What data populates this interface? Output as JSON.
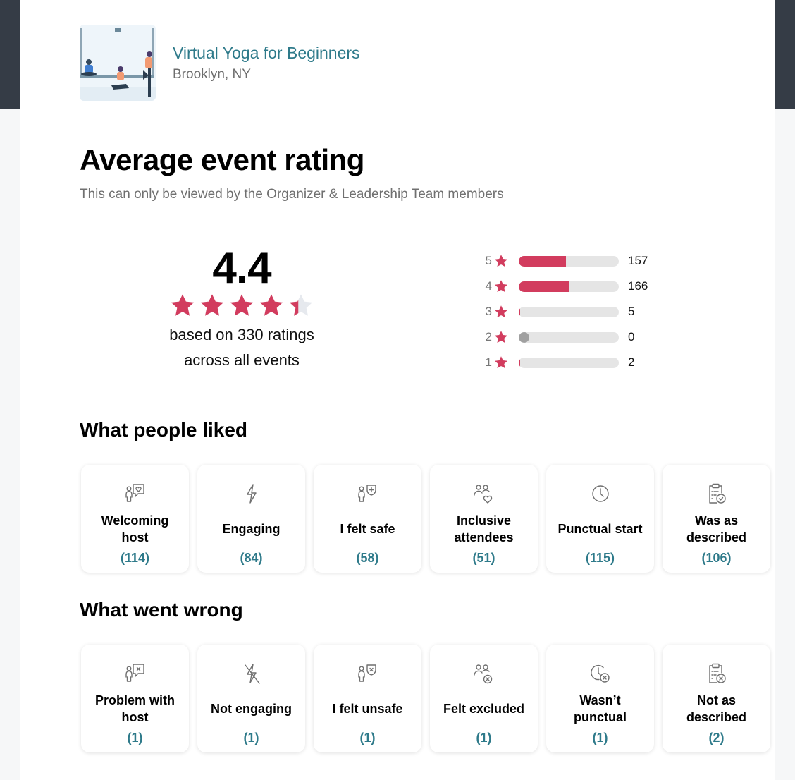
{
  "event": {
    "title": "Virtual Yoga for Beginners",
    "location": "Brooklyn, NY"
  },
  "header": {
    "title": "Average event rating",
    "subtitle": "This can only be viewed by the Organizer & Leadership Team members"
  },
  "summary": {
    "average": "4.4",
    "average_value": 4.4,
    "max_stars": 5,
    "caption_line1": "based on 330 ratings",
    "caption_line2": "across all events"
  },
  "distribution": [
    {
      "stars": "5",
      "count": "157",
      "fill_fraction": 0.47
    },
    {
      "stars": "4",
      "count": "166",
      "fill_fraction": 0.5
    },
    {
      "stars": "3",
      "count": "5",
      "fill_fraction": 0.015
    },
    {
      "stars": "2",
      "count": "0",
      "fill_fraction": 0
    },
    {
      "stars": "1",
      "count": "2",
      "fill_fraction": 0.006
    }
  ],
  "liked": {
    "title": "What people liked",
    "items": [
      {
        "icon": "person-speech-heart-icon",
        "label": "Welcoming host",
        "count": "(114)"
      },
      {
        "icon": "lightning-icon",
        "label": "Engaging",
        "count": "(84)"
      },
      {
        "icon": "person-shield-plus-icon",
        "label": "I felt safe",
        "count": "(58)"
      },
      {
        "icon": "people-heart-icon",
        "label": "Inclusive attendees",
        "count": "(51)"
      },
      {
        "icon": "clock-icon",
        "label": "Punctual start",
        "count": "(115)"
      },
      {
        "icon": "clipboard-check-icon",
        "label": "Was as described",
        "count": "(106)"
      }
    ]
  },
  "wrong": {
    "title": "What went wrong",
    "items": [
      {
        "icon": "person-speech-x-icon",
        "label": "Problem with host",
        "count": "(1)"
      },
      {
        "icon": "lightning-off-icon",
        "label": "Not engaging",
        "count": "(1)"
      },
      {
        "icon": "person-shield-x-icon",
        "label": "I felt unsafe",
        "count": "(1)"
      },
      {
        "icon": "people-x-icon",
        "label": "Felt excluded",
        "count": "(1)"
      },
      {
        "icon": "clock-x-icon",
        "label": "Wasn’t punctual",
        "count": "(1)"
      },
      {
        "icon": "clipboard-x-icon",
        "label": "Not as described",
        "count": "(2)"
      }
    ]
  },
  "colors": {
    "accent": "#d23c5e",
    "link": "#2e7a8a",
    "star_empty": "#e6e9ee",
    "bar_track": "#e5e5e5",
    "bar_zero": "#a0a0a0"
  }
}
